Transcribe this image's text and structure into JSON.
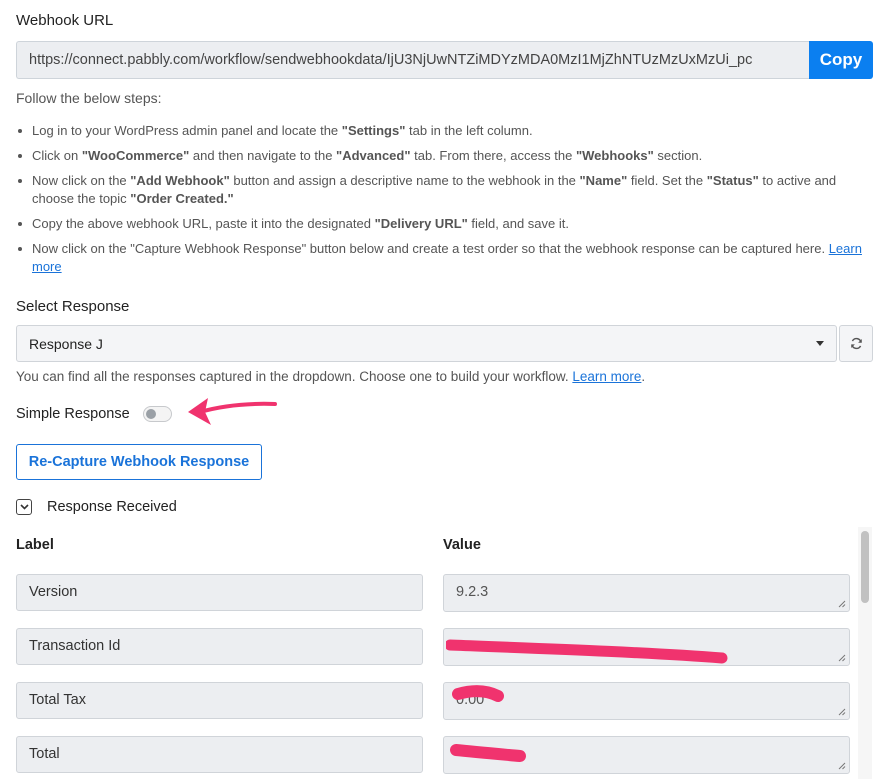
{
  "webhook": {
    "label": "Webhook URL",
    "url": "https://connect.pabbly.com/workflow/sendwebhookdata/IjU3NjUwNTZiMDYzMDA0MzI1MjZhNTUzMzUxMzUi_pc",
    "copy_label": "Copy"
  },
  "steps": {
    "title": "Follow the below steps:",
    "items": [
      {
        "p1": "Log in to your WordPress admin panel and locate the ",
        "b1": "\"Settings\"",
        "p2": " tab in the left column."
      },
      {
        "p1": "Click on ",
        "b1": "\"WooCommerce\"",
        "p2": " and then navigate to the ",
        "b2": "\"Advanced\"",
        "p3": " tab. From there, access the ",
        "b3": "\"Webhooks\"",
        "p4": " section."
      },
      {
        "p1": "Now click on the ",
        "b1": "\"Add Webhook\"",
        "p2": " button and assign a descriptive name to the webhook in the ",
        "b2": "\"Name\"",
        "p3": " field. Set the ",
        "b3": "\"Status\"",
        "p4": " to active and choose the topic ",
        "b4": "\"Order Created.\""
      },
      {
        "p1": "Copy the above webhook URL, paste it into the designated ",
        "b1": "\"Delivery URL\"",
        "p2": " field, and save it."
      },
      {
        "p1": "Now click on the \"Capture Webhook Response\" button below and create a test order so that the webhook response can be captured here. ",
        "link": "Learn more"
      }
    ]
  },
  "select_response": {
    "label": "Select Response",
    "selected": "Response J",
    "hint": "You can find all the responses captured in the dropdown. Choose one to build your workflow. ",
    "hint_link": "Learn more",
    "hint_end": "."
  },
  "simple_response": {
    "label": "Simple Response",
    "enabled": false
  },
  "recapture_label": "Re-Capture Webhook Response",
  "response_received": {
    "label": "Response Received",
    "col_label": "Label",
    "col_value": "Value",
    "rows": [
      {
        "label": "Version",
        "value": "9.2.3"
      },
      {
        "label": "Transaction Id",
        "value": ""
      },
      {
        "label": "Total Tax",
        "value": "0.00"
      },
      {
        "label": "Total",
        "value": ""
      }
    ]
  },
  "colors": {
    "accent": "#0b7ff0",
    "annotation": "#f0336e"
  }
}
